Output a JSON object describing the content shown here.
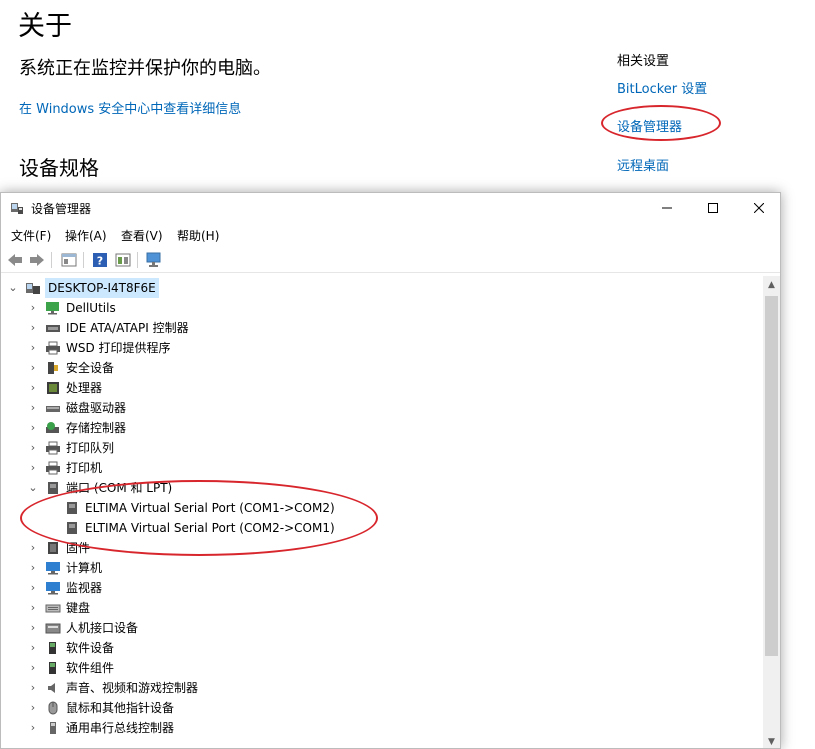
{
  "about": {
    "title": "关于",
    "status": "系统正在监控并保护你的电脑。",
    "security_link": "在 Windows 安全中心中查看详细信息",
    "specs_heading": "设备规格"
  },
  "related": {
    "title": "相关设置",
    "links": [
      "BitLocker 设置",
      "设备管理器",
      "远程桌面"
    ]
  },
  "window": {
    "title": "设备管理器",
    "minimize": "—",
    "maximize": "☐",
    "close": "✕"
  },
  "menu": [
    "文件(F)",
    "操作(A)",
    "查看(V)",
    "帮助(H)"
  ],
  "toolbar": [
    "back-icon",
    "forward-icon",
    "properties-icon",
    "help-icon",
    "update-driver-icon",
    "scan-hardware-icon"
  ],
  "tree": {
    "root": "DESKTOP-I4T8F6E",
    "categories": [
      "DellUtils",
      "IDE ATA/ATAPI 控制器",
      "WSD 打印提供程序",
      "安全设备",
      "处理器",
      "磁盘驱动器",
      "存储控制器",
      "打印队列",
      "打印机",
      "端口 (COM 和 LPT)",
      "ELTIMA Virtual Serial Port (COM1->COM2)",
      "ELTIMA Virtual Serial Port (COM2->COM1)",
      "固件",
      "计算机",
      "监视器",
      "键盘",
      "人机接口设备",
      "软件设备",
      "软件组件",
      "声音、视频和游戏控制器",
      "鼠标和其他指针设备",
      "通用串行总线控制器"
    ]
  },
  "colors": {
    "link": "#0067b8",
    "highlight": "#d8262d",
    "selection": "#cce8ff"
  }
}
